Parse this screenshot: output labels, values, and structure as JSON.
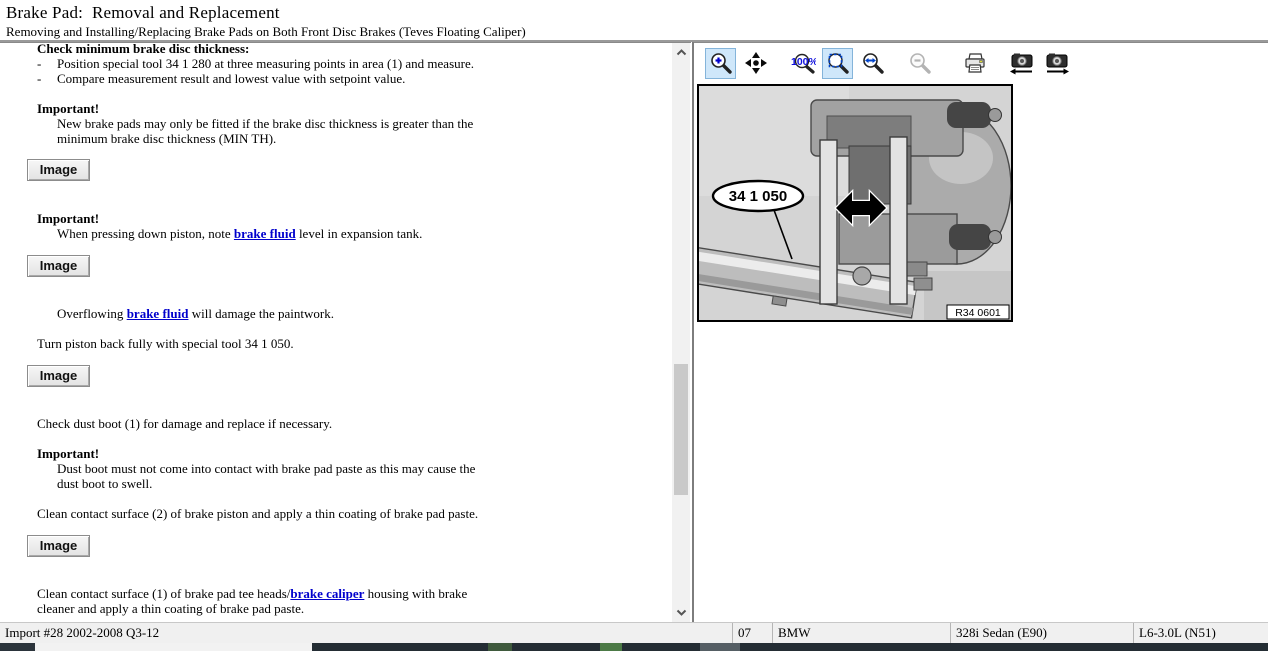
{
  "header": {
    "title": "Brake Pad:  Removal and Replacement",
    "subtitle": "Removing and Installing/Replacing Brake Pads on Both Front Disc Brakes (Teves Floating Caliper)"
  },
  "content": {
    "section_heading": "Check minimum brake disc thickness:",
    "bullet_marker": "-",
    "bullets": [
      "Position special tool 34 1 280 at three measuring points in area (1) and measure.",
      "Compare measurement result and lowest value with setpoint value."
    ],
    "important_label": "Important!",
    "important1_body": "New brake pads may only be fitted if the brake disc thickness is greater than the minimum brake disc thickness (MIN TH).",
    "image_button_label": "Image",
    "important2": {
      "pre": "When pressing down piston, note ",
      "link": "brake fluid",
      "post": " level in expansion tank."
    },
    "overflow_para": {
      "pre": "Overflowing ",
      "link": "brake fluid",
      "post": " will damage the paintwork."
    },
    "turn_piston_para": "Turn piston back fully with special tool 34 1 050.",
    "dust_boot_para": "Check dust boot (1) for damage and replace if necessary.",
    "important3_body": "Dust boot must not come into contact with brake pad paste as this may cause the dust boot to swell.",
    "clean_piston_para": "Clean contact surface (2) of brake piston and apply a thin coating of brake pad paste.",
    "clean_caliper_para": {
      "pre": "Clean contact surface (1) of brake pad tee heads/",
      "link": "brake caliper",
      "post": " housing with brake cleaner and apply a thin coating of brake pad paste."
    }
  },
  "toolbar": {
    "icons": [
      {
        "name": "zoom-in-icon",
        "state": "active"
      },
      {
        "name": "pan-icon",
        "state": "normal"
      },
      {
        "name": "zoom-100-icon",
        "state": "normal"
      },
      {
        "name": "zoom-fit-icon",
        "state": "active"
      },
      {
        "name": "zoom-width-icon",
        "state": "normal"
      },
      {
        "name": "zoom-out-icon",
        "state": "disabled"
      },
      {
        "name": "print-icon",
        "state": "normal"
      },
      {
        "name": "prev-image-icon",
        "state": "normal"
      },
      {
        "name": "next-image-icon",
        "state": "normal"
      }
    ]
  },
  "figure": {
    "tool_label": "34 1 050",
    "ref_label": "R34 0601"
  },
  "status_bar": {
    "cells": [
      "Import #28 2002-2008 Q3-12",
      "07",
      "BMW",
      "328i Sedan (E90)",
      "L6-3.0L (N51)"
    ]
  },
  "colors": {
    "link": "#0000cc",
    "toolbar_active_bg": "#cfe7fa",
    "toolbar_active_border": "#84b4da",
    "status_bg": "#f0f0f0",
    "taskbar_dark": "#242d34",
    "taskbar_green": "#4c7a46"
  }
}
